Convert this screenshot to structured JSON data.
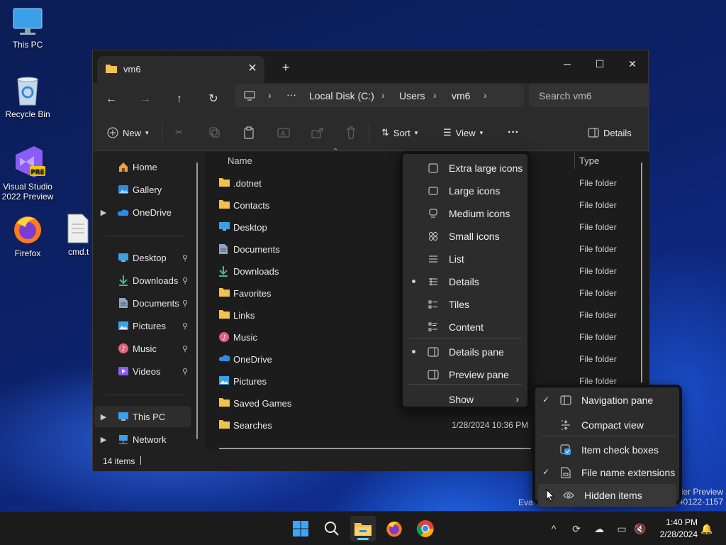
{
  "desktop": {
    "icons": [
      {
        "label": "This PC"
      },
      {
        "label": "Recycle Bin"
      },
      {
        "label": "Visual Studio 2022 Preview",
        "badge": "PRE"
      },
      {
        "label": "Firefox"
      },
      {
        "label": "cmd.t"
      }
    ],
    "watermark_line1": "der Preview",
    "watermark_line2": "40122-1157",
    "watermark_left": "Eva"
  },
  "window": {
    "tab_title": "vm6",
    "tab_close": "✕",
    "tab_add": "+",
    "min": "─",
    "max": "☐",
    "close": "✕"
  },
  "nav": {
    "back": "←",
    "forward": "→",
    "up": "↑",
    "refresh": "↻"
  },
  "address": {
    "more": "···",
    "crumbs": [
      "Local Disk (C:)",
      "Users",
      "vm6"
    ],
    "sep": "›"
  },
  "search": {
    "placeholder": "Search vm6"
  },
  "toolbar": {
    "new_label": "New",
    "sort_label": "Sort",
    "view_label": "View",
    "more": "···",
    "details_label": "Details"
  },
  "sidebar": {
    "items": [
      {
        "label": "Home",
        "icon": "home-icon"
      },
      {
        "label": "Gallery",
        "icon": "gallery-icon"
      },
      {
        "label": "OneDrive",
        "icon": "cloud-icon"
      },
      {
        "label": "Desktop",
        "icon": "desktop-icon"
      },
      {
        "label": "Downloads",
        "icon": "download-icon"
      },
      {
        "label": "Documents",
        "icon": "document-icon"
      },
      {
        "label": "Pictures",
        "icon": "picture-icon"
      },
      {
        "label": "Music",
        "icon": "music-icon"
      },
      {
        "label": "Videos",
        "icon": "video-icon"
      },
      {
        "label": "This PC",
        "icon": "computer-icon"
      },
      {
        "label": "Network",
        "icon": "network-icon"
      }
    ],
    "pin": "📌"
  },
  "columns": {
    "name": "Name",
    "type": "Type"
  },
  "files": [
    {
      "name": ".dotnet",
      "type": "File folder",
      "icon": "folder-icon"
    },
    {
      "name": "Contacts",
      "type": "File folder",
      "icon": "folder-icon"
    },
    {
      "name": "Desktop",
      "type": "File folder",
      "icon": "desktop-icon"
    },
    {
      "name": "Documents",
      "type": "File folder",
      "icon": "document-icon"
    },
    {
      "name": "Downloads",
      "type": "File folder",
      "icon": "download-icon"
    },
    {
      "name": "Favorites",
      "type": "File folder",
      "icon": "folder-icon"
    },
    {
      "name": "Links",
      "type": "File folder",
      "icon": "folder-icon"
    },
    {
      "name": "Music",
      "type": "File folder",
      "icon": "music-icon"
    },
    {
      "name": "OneDrive",
      "type": "File folder",
      "icon": "cloud-icon"
    },
    {
      "name": "Pictures",
      "type": "File folder",
      "icon": "picture-icon"
    },
    {
      "name": "Saved Games",
      "type": "",
      "icon": "folder-icon"
    },
    {
      "name": "Searches",
      "date": "1/28/2024 10:36 PM",
      "type": "",
      "icon": "folder-icon"
    }
  ],
  "status": {
    "count": "14 items"
  },
  "view_menu": {
    "items": [
      {
        "label": "Extra large icons",
        "selected": false
      },
      {
        "label": "Large icons",
        "selected": false
      },
      {
        "label": "Medium icons",
        "selected": false
      },
      {
        "label": "Small icons",
        "selected": false
      },
      {
        "label": "List",
        "selected": false
      },
      {
        "label": "Details",
        "selected": true
      },
      {
        "label": "Tiles",
        "selected": false
      },
      {
        "label": "Content",
        "selected": false
      },
      {
        "label": "Details pane",
        "selected": true
      },
      {
        "label": "Preview pane",
        "selected": false
      },
      {
        "label": "Show",
        "selected": false
      }
    ],
    "arrow": "›"
  },
  "show_menu": {
    "items": [
      {
        "label": "Navigation pane",
        "checked": true
      },
      {
        "label": "Compact view",
        "checked": false
      },
      {
        "label": "Item check boxes",
        "checked": false
      },
      {
        "label": "File name extensions",
        "checked": true
      },
      {
        "label": "Hidden items",
        "checked": true
      }
    ],
    "check": "✓"
  },
  "taskbar": {
    "tray_up": "^",
    "time": "1:40 PM",
    "date": "2/28/2024"
  },
  "colors": {
    "accent": "#60cdff",
    "folder": "#f3c14d",
    "window_bg": "#202020"
  }
}
